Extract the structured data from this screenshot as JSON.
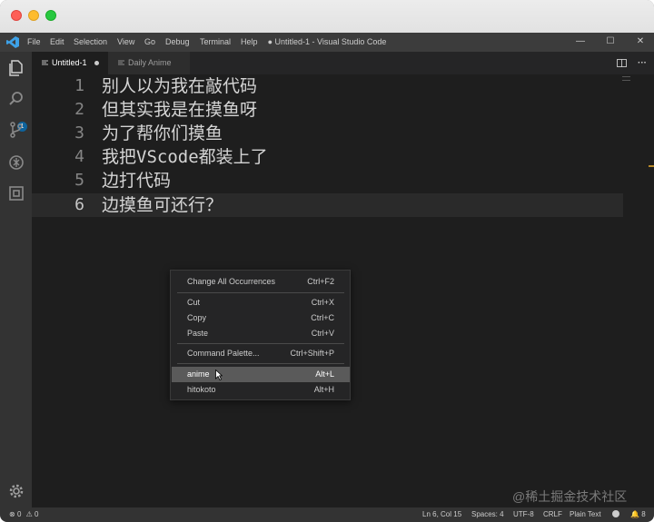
{
  "menubar": {
    "items": [
      "File",
      "Edit",
      "Selection",
      "View",
      "Go",
      "Debug",
      "Terminal",
      "Help"
    ],
    "window_title": "● Untitled-1 - Visual Studio Code"
  },
  "activity_bar": {
    "icons": [
      "files-icon",
      "search-icon",
      "source-control-icon",
      "debug-icon",
      "extensions-icon",
      "gear-icon"
    ],
    "badge": "1"
  },
  "tabs": [
    {
      "label": "Untitled-1",
      "active": true,
      "dirty": true
    },
    {
      "label": "Daily Anime",
      "active": false,
      "dirty": false
    }
  ],
  "editor": {
    "lines": [
      {
        "num": "1",
        "text": "别人以为我在敲代码"
      },
      {
        "num": "2",
        "text": "但其实我是在摸鱼呀"
      },
      {
        "num": "3",
        "text": "为了帮你们摸鱼"
      },
      {
        "num": "4",
        "text": "我把VScode都装上了"
      },
      {
        "num": "5",
        "text": "边打代码"
      },
      {
        "num": "6",
        "text": "边摸鱼可还行？"
      }
    ],
    "current_line": 6
  },
  "context_menu": {
    "items": [
      {
        "label": "Change All Occurrences",
        "key": "Ctrl+F2"
      },
      {
        "label": "Cut",
        "key": "Ctrl+X"
      },
      {
        "label": "Copy",
        "key": "Ctrl+C"
      },
      {
        "label": "Paste",
        "key": "Ctrl+V"
      },
      {
        "label": "Command Palette...",
        "key": "Ctrl+Shift+P"
      },
      {
        "label": "anime",
        "key": "Alt+L"
      },
      {
        "label": "hitokoto",
        "key": "Alt+H"
      }
    ],
    "highlighted": "anime"
  },
  "status_bar": {
    "errors": "0",
    "warnings": "0",
    "position": "Ln 6, Col 15",
    "spaces": "Spaces: 4",
    "encoding": "UTF-8",
    "eol": "CRLF",
    "language": "Plain Text",
    "notifications": "8"
  },
  "watermark": "@稀土掘金技术社区",
  "colors": {
    "activity_bar": "#333333",
    "editor_bg": "#1e1e1e",
    "menubar_bg": "#3c3c3c",
    "menu_highlight": "#5a5a5a",
    "badge": "#0e639c"
  }
}
